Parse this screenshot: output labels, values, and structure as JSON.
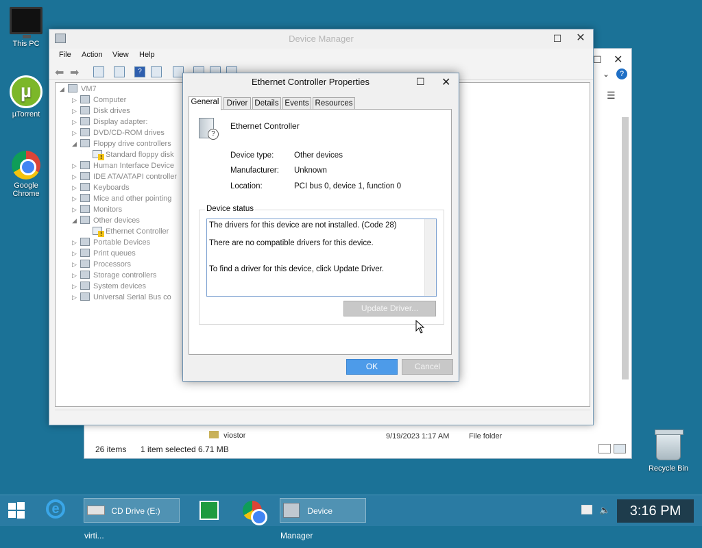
{
  "desktop": {
    "icons": [
      {
        "label": "This PC"
      },
      {
        "label": "µTorrent"
      },
      {
        "label": "Google Chrome"
      },
      {
        "label": "Recycle Bin"
      }
    ]
  },
  "explorer": {
    "row": {
      "name": "viostor",
      "date": "9/19/2023 1:17 AM",
      "type": "File folder"
    },
    "status": {
      "items": "26 items",
      "selected": "1 item selected  6.71 MB"
    }
  },
  "device_manager": {
    "title": "Device Manager",
    "menu": [
      "File",
      "Action",
      "View",
      "Help"
    ],
    "tree": [
      {
        "label": "VM7",
        "level": 0,
        "expanded": true
      },
      {
        "label": "Computer",
        "level": 1
      },
      {
        "label": "Disk drives",
        "level": 1
      },
      {
        "label": "Display adapter:",
        "level": 1
      },
      {
        "label": "DVD/CD-ROM drives",
        "level": 1
      },
      {
        "label": "Floppy drive controllers",
        "level": 1,
        "expanded": true
      },
      {
        "label": "Standard floppy disk",
        "level": 2,
        "warn": true
      },
      {
        "label": "Human Interface Device",
        "level": 1
      },
      {
        "label": "IDE ATA/ATAPI controller",
        "level": 1
      },
      {
        "label": "Keyboards",
        "level": 1
      },
      {
        "label": "Mice and other pointing",
        "level": 1
      },
      {
        "label": "Monitors",
        "level": 1
      },
      {
        "label": "Other devices",
        "level": 1,
        "expanded": true
      },
      {
        "label": "Ethernet Controller",
        "level": 2,
        "warn": true
      },
      {
        "label": "Portable Devices",
        "level": 1
      },
      {
        "label": "Print queues",
        "level": 1
      },
      {
        "label": "Processors",
        "level": 1
      },
      {
        "label": "Storage controllers",
        "level": 1
      },
      {
        "label": "System devices",
        "level": 1
      },
      {
        "label": "Universal Serial Bus co",
        "level": 1
      }
    ]
  },
  "dialog": {
    "title": "Ethernet Controller Properties",
    "tabs": [
      "General",
      "Driver",
      "Details",
      "Events",
      "Resources"
    ],
    "device_name": "Ethernet Controller",
    "fields": [
      {
        "label": "Device type:",
        "value": "Other devices"
      },
      {
        "label": "Manufacturer:",
        "value": "Unknown"
      },
      {
        "label": "Location:",
        "value": "PCI bus 0, device 1, function 0"
      }
    ],
    "status_group": "Device status",
    "status_lines": [
      "The drivers for this device are not installed. (Code 28)",
      "There are no compatible drivers for this device.",
      "To find a driver for this device, click Update Driver."
    ],
    "update_button": "Update Driver...",
    "ok": "OK",
    "cancel": "Cancel"
  },
  "taskbar": {
    "cd_drive": "CD Drive (E:) virti...",
    "device_manager": "Device Manager",
    "clock": "3:16 PM"
  }
}
